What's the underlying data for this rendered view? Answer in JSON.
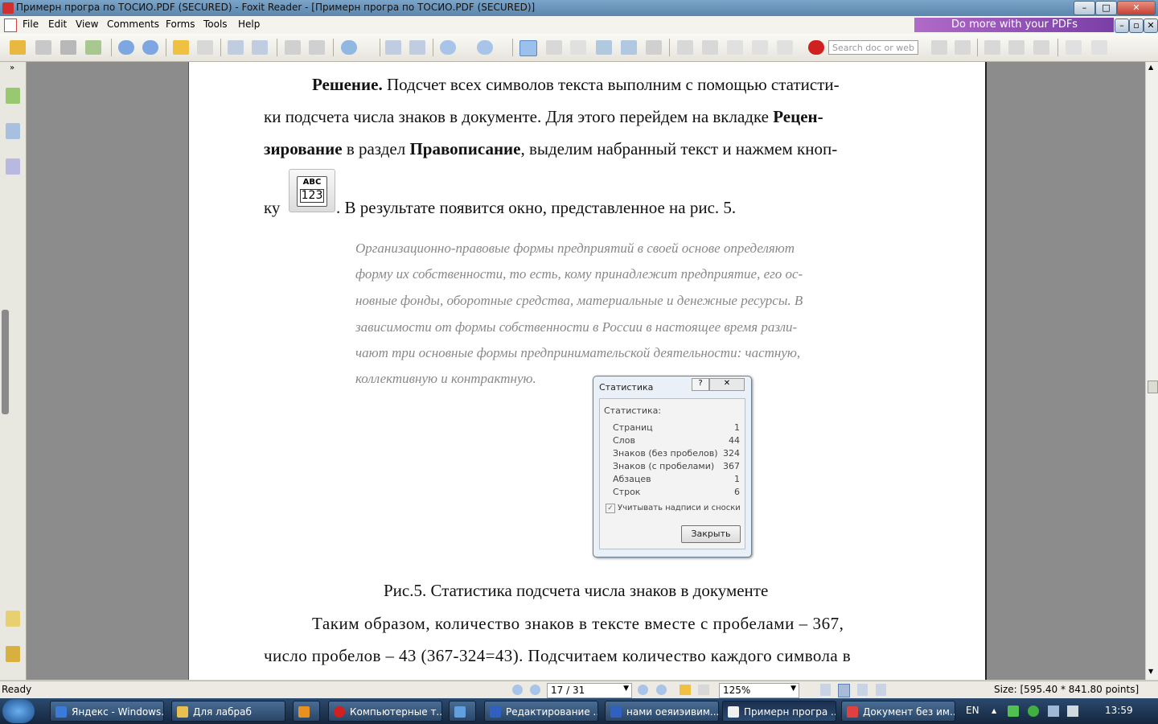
{
  "window": {
    "title": "Примерн програ по ТОСИО.PDF (SECURED) - Foxit Reader - [Примерн програ по ТОСИО.PDF (SECURED)]",
    "min": "–",
    "max": "□",
    "close": "✕"
  },
  "menu": [
    "File",
    "Edit",
    "View",
    "Comments",
    "Forms",
    "Tools",
    "Help"
  ],
  "promo": "Do more with your PDFs",
  "toolbar": {
    "search_placeholder": "Search doc or web"
  },
  "document": {
    "p1_bold": "Решение.",
    "p1_rest": " Подсчет всех символов текста выполним с помощью статисти-",
    "p2_start": "ки подсчета числа знаков в документе. Для этого перейдем на вкладке ",
    "p2_bold": "Рецен-",
    "p3_bold1": "зирование",
    "p3_mid": " в раздел ",
    "p3_bold2": "Правописание",
    "p3_end": ", выделим набранный текст и нажмем кноп-",
    "p4_start": "ку",
    "button_icon_top": "ABC",
    "button_icon_bottom": "123",
    "p4_end": ". В результате появится окно, представленное на рис. 5.",
    "quote": [
      "Организационно-правовые формы предприятий в своей основе определяют",
      "форму их собственности, то есть, кому принадлежит предприятие, его ос-",
      "новные фонды, оборотные средства, материальные и денежные ресурсы. В",
      "зависимости от формы собственности в России в настоящее время разли-",
      "чают три основные формы предпринимательской деятельности: частную,",
      "коллективную и контрактную."
    ],
    "caption": "Рис.5. Статистика подсчета числа знаков в документе",
    "p5": "Таким образом, количество знаков в тексте вместе с пробелами – 367,",
    "p6": "число пробелов – 43 (367-324=43). Подсчитаем количество каждого символа в"
  },
  "dialog": {
    "title": "Статистика",
    "help": "?",
    "close": "✕",
    "section": "Статистика:",
    "rows": [
      {
        "label": "Страниц",
        "value": "1"
      },
      {
        "label": "Слов",
        "value": "44"
      },
      {
        "label": "Знаков (без пробелов)",
        "value": "324"
      },
      {
        "label": "Знаков (с пробелами)",
        "value": "367"
      },
      {
        "label": "Абзацев",
        "value": "1"
      },
      {
        "label": "Строк",
        "value": "6"
      }
    ],
    "checkbox_label": "Учитывать надписи и сноски",
    "checkbox_mark": "✓",
    "close_button": "Закрыть"
  },
  "status": {
    "ready": "Ready",
    "page": "17 / 31",
    "zoom": "125%",
    "size": "Size: [595.40 * 841.80 points]"
  },
  "taskbar": {
    "tasks": [
      {
        "label": "Яндекс - Windows...",
        "color": "#3a7ad8"
      },
      {
        "label": "Для лабраб",
        "color": "#e8c050"
      },
      {
        "label": "",
        "color": "#e89020"
      },
      {
        "label": "Компьютерные т...",
        "color": "#d02020"
      },
      {
        "label": "",
        "color": "#60a0e0"
      },
      {
        "label": "Редактирование ...",
        "color": "#3060c0"
      },
      {
        "label": "нами оеяиэивим...",
        "color": "#3060c0"
      },
      {
        "label": "Примерн програ ...",
        "color": "#f0f0f0"
      },
      {
        "label": "Документ без им...",
        "color": "#e04040"
      }
    ],
    "lang": "EN",
    "time": "13:59"
  }
}
